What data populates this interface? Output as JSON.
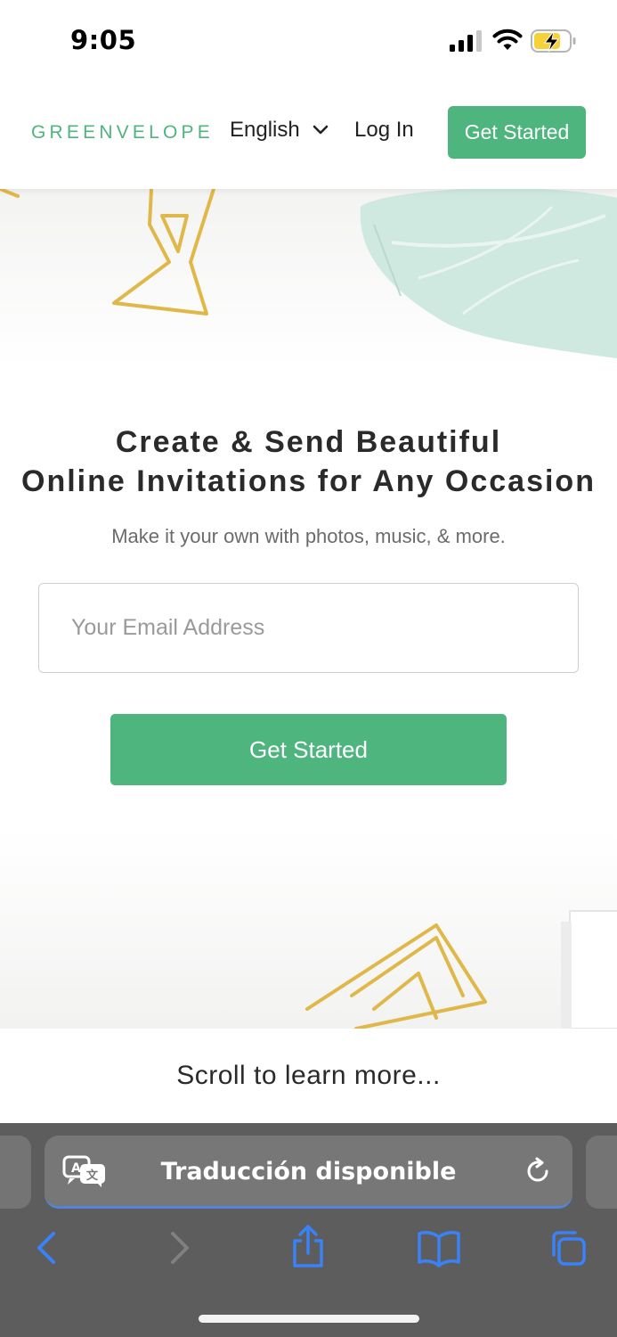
{
  "status_bar": {
    "time": "9:05",
    "icons": [
      "signal-icon",
      "wifi-icon",
      "battery-charging-icon"
    ]
  },
  "header": {
    "logo": "GREENVELOPE",
    "language": "English",
    "login": "Log In",
    "cta": "Get Started"
  },
  "hero": {
    "title_line1": "Create & Send Beautiful",
    "title_line2": "Online Invitations for Any Occasion",
    "subtitle": "Make it your own with photos, music, & more.",
    "email_placeholder": "Your Email Address",
    "email_value": "",
    "cta": "Get Started"
  },
  "scroll_hint": "Scroll to learn more...",
  "browser": {
    "address_text": "Traducción disponible",
    "icons": [
      "translate-icon",
      "reload-icon",
      "back-icon",
      "forward-icon",
      "share-icon",
      "bookmarks-icon",
      "tabs-icon"
    ]
  },
  "colors": {
    "brand_green": "#4fb57f",
    "toolbar_gray": "#5d5d5d",
    "ios_blue": "#3a82f7"
  }
}
